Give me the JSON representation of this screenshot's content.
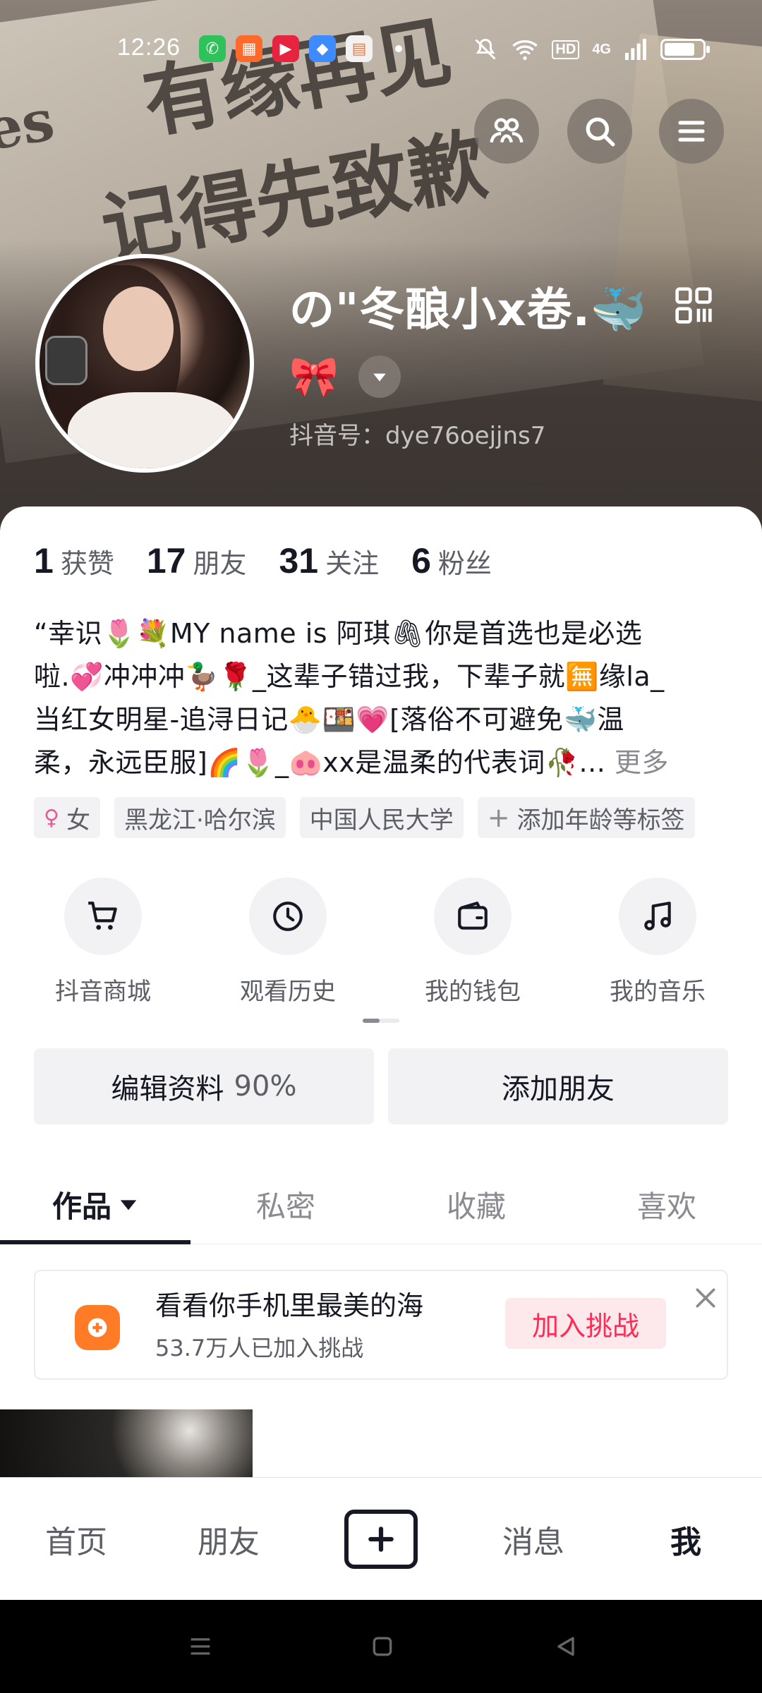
{
  "status_bar": {
    "time": "12:26",
    "indicators": [
      "mute-icon",
      "wifi-icon",
      "HD",
      "4G",
      "signal-icon",
      "battery-icon"
    ],
    "battery_level": 0.8
  },
  "top_actions": [
    "friends-icon",
    "search-icon",
    "menu-icon"
  ],
  "profile": {
    "name": "の\"冬酿小x卷.🐳",
    "badge": "🎀",
    "douyin_id": "抖音号：dye76oejjns7"
  },
  "stats": [
    {
      "num": "1",
      "label": "获赞"
    },
    {
      "num": "17",
      "label": "朋友"
    },
    {
      "num": "31",
      "label": "关注"
    },
    {
      "num": "6",
      "label": "粉丝"
    }
  ],
  "bio": {
    "lines": [
      "“幸识🌷💐MY name is 阿琪🖇你是首选也是必选",
      "啦.💞冲冲冲🦆🌹_这辈子错过我，下辈子就🈚缘la_",
      "当红女明星-追浔日记🐣🍱💗[落俗不可避免🐳温",
      "柔，永远臣服]🌈🌷_🐽xx是温柔的代表词🥀..."
    ],
    "more": "更多"
  },
  "tags": [
    {
      "symbol": "♀",
      "label": "女"
    },
    {
      "symbol": "",
      "label": "黑龙江·哈尔滨"
    },
    {
      "symbol": "",
      "label": "中国人民大学"
    },
    {
      "symbol": "+",
      "label": "添加年龄等标签"
    }
  ],
  "shortcuts": [
    {
      "icon": "cart-icon",
      "label": "抖音商城"
    },
    {
      "icon": "clock-icon",
      "label": "观看历史"
    },
    {
      "icon": "wallet-icon",
      "label": "我的钱包"
    },
    {
      "icon": "music-note-icon",
      "label": "我的音乐"
    }
  ],
  "actions": {
    "edit_label": "编辑资料",
    "edit_percent": "90%",
    "add_friend_label": "添加朋友"
  },
  "tabs": [
    {
      "label": "作品",
      "active": true
    },
    {
      "label": "私密",
      "active": false
    },
    {
      "label": "收藏",
      "active": false
    },
    {
      "label": "喜欢",
      "active": false
    }
  ],
  "challenge": {
    "title": "看看你手机里最美的海",
    "subtitle": "53.7万人已加入挑战",
    "join_label": "加入挑战"
  },
  "bottom_nav": {
    "home": "首页",
    "friends": "朋友",
    "messages": "消息",
    "me": "我"
  },
  "colors": {
    "accent": "#fe2c55",
    "challenge_icon": "#ff7b26",
    "text_primary": "#161823",
    "text_secondary": "#5d5f67"
  }
}
